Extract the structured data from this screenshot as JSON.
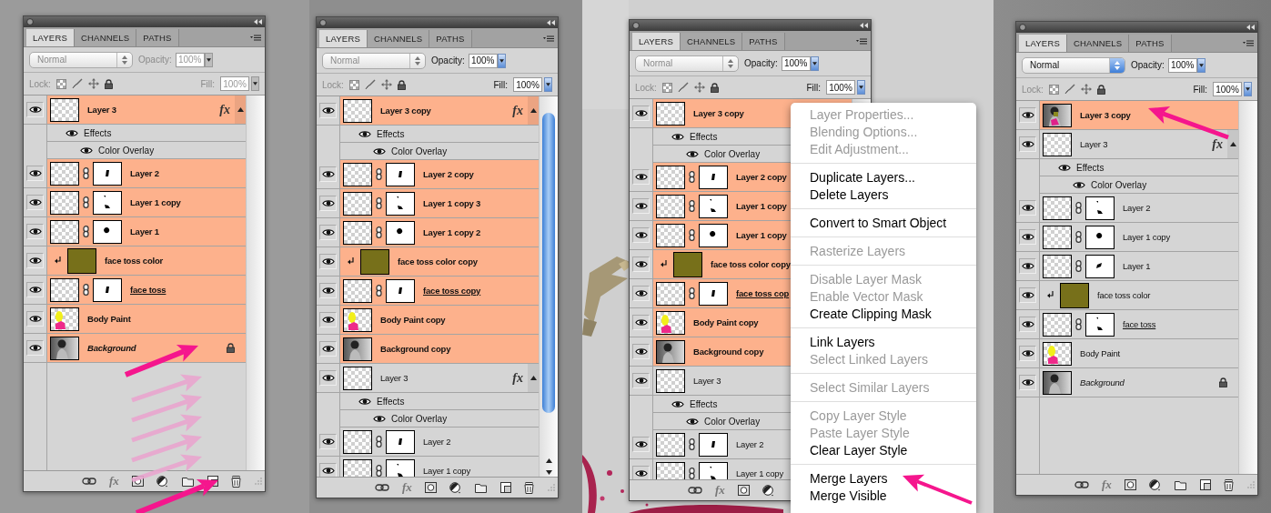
{
  "panels": [
    {
      "tabs": [
        {
          "label": "LAYERS",
          "selected": true
        },
        {
          "label": "CHANNELS",
          "selected": false
        },
        {
          "label": "PATHS",
          "selected": false
        }
      ],
      "blend_mode": {
        "value": "Normal",
        "disabled": true
      },
      "opacity": {
        "label": "Opacity:",
        "value": "100%",
        "disabled": true
      },
      "lock_label": "Lock:",
      "fill": {
        "label": "Fill:",
        "value": "100%",
        "disabled": true
      },
      "scrollbar": false,
      "layers": [
        {
          "name": "Layer 3",
          "kind": "transparent",
          "mask": false,
          "selected": true,
          "locked": false,
          "underlined": false,
          "fx": "fx",
          "effects": {
            "label": "Effects",
            "items": [
              "Color Overlay"
            ]
          }
        },
        {
          "name": "Layer 2",
          "kind": "transparent",
          "mask": true,
          "selected": true,
          "locked": false,
          "underlined": false
        },
        {
          "name": "Layer 1 copy",
          "kind": "transparent",
          "mask": true,
          "selected": true,
          "locked": false,
          "underlined": false
        },
        {
          "name": "Layer 1",
          "kind": "transparent",
          "mask": true,
          "selected": true,
          "locked": false,
          "underlined": false
        },
        {
          "name": "face toss color",
          "kind": "fill",
          "mask": false,
          "selected": true,
          "locked": false,
          "underlined": false
        },
        {
          "name": "face toss",
          "kind": "transparent",
          "mask": true,
          "selected": true,
          "locked": false,
          "underlined": true
        },
        {
          "name": "Body Paint",
          "kind": "paint",
          "mask": false,
          "selected": true,
          "locked": false,
          "underlined": false
        },
        {
          "name": "Background",
          "mask": false,
          "selected": true,
          "locked": true,
          "underlined": false
        }
      ],
      "footer": [
        {
          "kind": "link"
        },
        {
          "kind": "fx",
          "label": "fx"
        },
        {
          "kind": "mask"
        },
        {
          "kind": "adjust"
        },
        {
          "kind": "folder"
        },
        {
          "kind": "new"
        },
        {
          "kind": "trash"
        }
      ]
    },
    {
      "tabs": [
        {
          "label": "LAYERS",
          "selected": true
        },
        {
          "label": "CHANNELS",
          "selected": false
        },
        {
          "label": "PATHS",
          "selected": false
        }
      ],
      "blend_mode": {
        "value": "Normal",
        "disabled": true
      },
      "opacity": {
        "label": "Opacity:",
        "value": "100%",
        "disabled": false
      },
      "lock_label": "Lock:",
      "fill": {
        "label": "Fill:",
        "value": "100%",
        "disabled": false
      },
      "scrollbar": true,
      "layers": [
        {
          "name": "Layer 3 copy",
          "kind": "transparent",
          "mask": false,
          "selected": true,
          "locked": false,
          "underlined": false,
          "fx": "fx",
          "effects": {
            "label": "Effects",
            "items": [
              "Color Overlay"
            ]
          }
        },
        {
          "name": "Layer 2 copy",
          "kind": "transparent",
          "mask": true,
          "selected": true,
          "locked": false,
          "underlined": false
        },
        {
          "name": "Layer 1 copy 3",
          "kind": "transparent",
          "mask": true,
          "selected": true,
          "locked": false,
          "underlined": false
        },
        {
          "name": "Layer 1 copy 2",
          "kind": "transparent",
          "mask": true,
          "selected": true,
          "locked": false,
          "underlined": false
        },
        {
          "name": "face toss color copy",
          "kind": "fill",
          "mask": false,
          "selected": true,
          "locked": false,
          "underlined": false
        },
        {
          "name": "face toss copy",
          "kind": "transparent",
          "mask": true,
          "selected": true,
          "locked": false,
          "underlined": true
        },
        {
          "name": "Body Paint copy",
          "kind": "paint",
          "mask": false,
          "selected": true,
          "locked": false,
          "underlined": false
        },
        {
          "name": "Background copy",
          "mask": false,
          "selected": true,
          "locked": false,
          "underlined": false
        },
        {
          "name": "Layer 3",
          "kind": "transparent",
          "mask": false,
          "selected": false,
          "locked": false,
          "underlined": false,
          "fx": "fx",
          "effects": {
            "label": "Effects",
            "items": [
              "Color Overlay"
            ]
          }
        },
        {
          "name": "Layer 2",
          "kind": "transparent",
          "mask": true,
          "selected": false,
          "locked": false,
          "underlined": false
        },
        {
          "name": "Layer 1 copy",
          "kind": "transparent",
          "mask": true,
          "selected": false,
          "locked": false,
          "underlined": false
        }
      ],
      "footer": [
        {
          "kind": "link"
        },
        {
          "kind": "fx",
          "label": "fx"
        },
        {
          "kind": "mask"
        },
        {
          "kind": "adjust"
        },
        {
          "kind": "folder"
        },
        {
          "kind": "new"
        },
        {
          "kind": "trash"
        }
      ]
    },
    {
      "tabs": [
        {
          "label": "LAYERS",
          "selected": true
        },
        {
          "label": "CHANNELS",
          "selected": false
        },
        {
          "label": "PATHS",
          "selected": false
        }
      ],
      "blend_mode": {
        "value": "Normal",
        "disabled": true
      },
      "opacity": {
        "label": "Opacity:",
        "value": "100%",
        "disabled": false
      },
      "lock_label": "Lock:",
      "fill": {
        "label": "Fill:",
        "value": "100%",
        "disabled": false
      },
      "scrollbar": false,
      "layers": [
        {
          "name": "Layer 3 copy",
          "kind": "transparent",
          "mask": false,
          "selected": true,
          "locked": false,
          "underlined": false,
          "effects": {
            "label": "Effects",
            "items": [
              "Color Overlay"
            ]
          }
        },
        {
          "name": "Layer 2 copy",
          "kind": "transparent",
          "mask": true,
          "selected": true,
          "locked": false,
          "underlined": false
        },
        {
          "name": "Layer 1 copy",
          "kind": "transparent",
          "mask": true,
          "selected": true,
          "locked": false,
          "underlined": false
        },
        {
          "name": "Layer 1 copy",
          "kind": "transparent",
          "mask": true,
          "selected": true,
          "locked": false,
          "underlined": false
        },
        {
          "name": "face toss color copy",
          "kind": "fill",
          "mask": false,
          "selected": true,
          "locked": false,
          "underlined": false
        },
        {
          "name": "face toss cop",
          "kind": "transparent",
          "mask": true,
          "selected": true,
          "locked": false,
          "underlined": true
        },
        {
          "name": "Body Paint copy",
          "kind": "paint",
          "mask": false,
          "selected": true,
          "locked": false,
          "underlined": false
        },
        {
          "name": "Background copy",
          "mask": false,
          "selected": true,
          "locked": false,
          "underlined": false
        },
        {
          "name": "Layer 3",
          "kind": "transparent",
          "mask": false,
          "selected": false,
          "locked": false,
          "underlined": false,
          "effects": {
            "label": "Effects",
            "items": [
              "Color Overlay"
            ]
          }
        },
        {
          "name": "Layer 2",
          "kind": "transparent",
          "mask": true,
          "selected": false,
          "locked": false,
          "underlined": false
        },
        {
          "name": "Layer 1 copy",
          "kind": "transparent",
          "mask": true,
          "selected": false,
          "locked": false,
          "underlined": false
        }
      ],
      "footer": [
        {
          "kind": "link"
        },
        {
          "kind": "fx",
          "label": "fx"
        },
        {
          "kind": "mask"
        },
        {
          "kind": "adjust"
        }
      ]
    },
    {
      "tabs": [
        {
          "label": "LAYERS",
          "selected": true
        },
        {
          "label": "CHANNELS",
          "selected": false
        },
        {
          "label": "PATHS",
          "selected": false
        }
      ],
      "blend_mode": {
        "value": "Normal",
        "disabled": false
      },
      "opacity": {
        "label": "Opacity:",
        "value": "100%",
        "disabled": false
      },
      "lock_label": "Lock:",
      "fill": {
        "label": "Fill:",
        "value": "100%",
        "disabled": false
      },
      "scrollbar": false,
      "layers": [
        {
          "name": "Layer 3 copy",
          "kind": "merged",
          "mask": false,
          "selected": true,
          "locked": false,
          "underlined": false
        },
        {
          "name": "Layer 3",
          "kind": "transparent",
          "mask": false,
          "selected": false,
          "locked": false,
          "underlined": false,
          "fx": "fx",
          "effects": {
            "label": "Effects",
            "items": [
              "Color Overlay"
            ]
          }
        },
        {
          "name": "Layer 2",
          "kind": "transparent",
          "mask": true,
          "selected": false,
          "locked": false,
          "underlined": false
        },
        {
          "name": "Layer 1 copy",
          "kind": "transparent",
          "mask": true,
          "selected": false,
          "locked": false,
          "underlined": false
        },
        {
          "name": "Layer 1",
          "kind": "transparent",
          "mask": true,
          "selected": false,
          "locked": false,
          "underlined": false
        },
        {
          "name": "face toss color",
          "kind": "fill",
          "mask": false,
          "selected": false,
          "locked": false,
          "underlined": false
        },
        {
          "name": "face toss",
          "kind": "transparent",
          "mask": true,
          "selected": false,
          "locked": false,
          "underlined": true
        },
        {
          "name": "Body Paint",
          "kind": "paint",
          "mask": false,
          "selected": false,
          "locked": false,
          "underlined": false
        },
        {
          "name": "Background",
          "mask": false,
          "selected": false,
          "locked": true,
          "underlined": false
        }
      ],
      "footer": [
        {
          "kind": "link"
        },
        {
          "kind": "fx",
          "label": "fx"
        },
        {
          "kind": "mask"
        },
        {
          "kind": "adjust"
        },
        {
          "kind": "folder"
        },
        {
          "kind": "new"
        },
        {
          "kind": "trash"
        }
      ]
    }
  ],
  "context_menu": {
    "sections": [
      [
        {
          "label": "Layer Properties...",
          "disabled": true
        },
        {
          "label": "Blending Options...",
          "disabled": true
        },
        {
          "label": "Edit Adjustment...",
          "disabled": true
        }
      ],
      [
        {
          "label": "Duplicate Layers...",
          "disabled": false
        },
        {
          "label": "Delete Layers",
          "disabled": false
        }
      ],
      [
        {
          "label": "Convert to Smart Object",
          "disabled": false
        }
      ],
      [
        {
          "label": "Rasterize Layers",
          "disabled": true
        }
      ],
      [
        {
          "label": "Disable Layer Mask",
          "disabled": true
        },
        {
          "label": "Enable Vector Mask",
          "disabled": true
        },
        {
          "label": "Create Clipping Mask",
          "disabled": false
        }
      ],
      [
        {
          "label": "Link Layers",
          "disabled": false
        },
        {
          "label": "Select Linked Layers",
          "disabled": true
        }
      ],
      [
        {
          "label": "Select Similar Layers",
          "disabled": true
        }
      ],
      [
        {
          "label": "Copy Layer Style",
          "disabled": true
        },
        {
          "label": "Paste Layer Style",
          "disabled": true
        },
        {
          "label": "Clear Layer Style",
          "disabled": false
        }
      ],
      [
        {
          "label": "Merge Layers",
          "disabled": false
        },
        {
          "label": "Merge Visible",
          "disabled": false
        }
      ]
    ]
  }
}
